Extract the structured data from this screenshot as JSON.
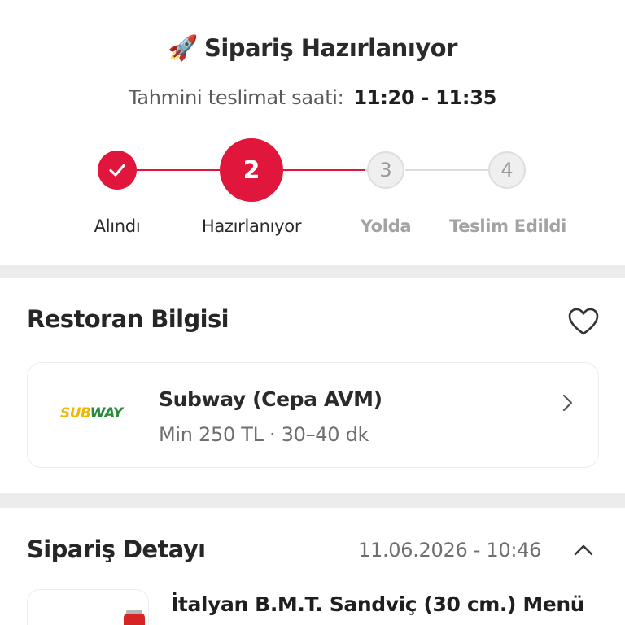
{
  "order_status": {
    "icon": "rocket-icon",
    "title": "Sipariş Hazırlanıyor",
    "eta_label": "Tahmini teslimat saati:",
    "eta_value": "11:20 - 11:35",
    "steps": [
      {
        "label": "Alındı",
        "state": "done"
      },
      {
        "label": "Hazırlanıyor",
        "number": "2",
        "state": "active"
      },
      {
        "label": "Yolda",
        "number": "3",
        "state": "todo"
      },
      {
        "label": "Teslim Edildi",
        "number": "4",
        "state": "todo"
      }
    ]
  },
  "restaurant": {
    "section_title": "Restoran Bilgisi",
    "logo_text_1": "SUB",
    "logo_text_2": "WAY",
    "name": "Subway (Cepa AVM)",
    "meta": "Min 250 TL · 30–40 dk"
  },
  "order_detail": {
    "section_title": "Sipariş Detayı",
    "date": "11.06.2026 - 10:46",
    "items": [
      {
        "name": "İtalyan B.M.T. Sandviç (30 cm.) Menü"
      }
    ]
  },
  "colors": {
    "accent": "#e0163d",
    "inactive": "#a3a3a3",
    "background": "#ececec"
  }
}
